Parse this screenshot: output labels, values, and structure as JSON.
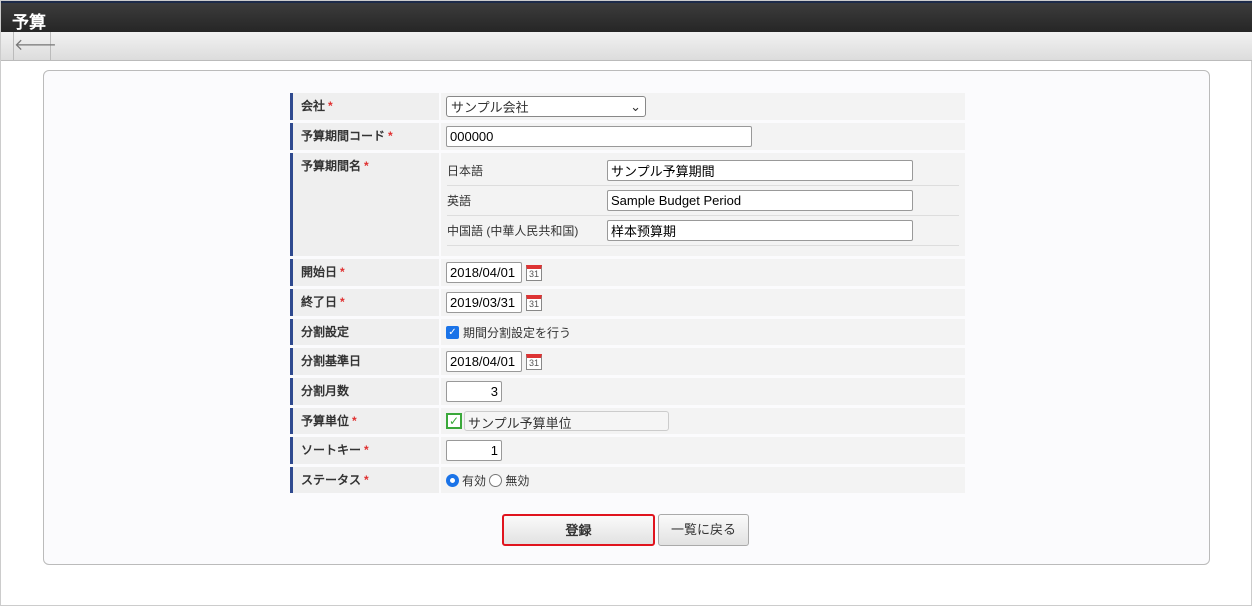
{
  "header": {
    "title": "予算"
  },
  "toolbar": {
    "back": "🡐"
  },
  "form": {
    "company": {
      "label": "会社",
      "value": "サンプル会社"
    },
    "code": {
      "label": "予算期間コード",
      "value": "000000"
    },
    "name": {
      "label": "予算期間名",
      "langs": [
        {
          "label": "日本語",
          "value": "サンプル予算期間"
        },
        {
          "label": "英語",
          "value": "Sample Budget Period"
        },
        {
          "label": "中国語 (中華人民共和国)",
          "value": "样本预算期"
        }
      ]
    },
    "start": {
      "label": "開始日",
      "value": "2018/04/01"
    },
    "end": {
      "label": "終了日",
      "value": "2019/03/31"
    },
    "split": {
      "label": "分割設定",
      "checkbox": "期間分割設定を行う"
    },
    "base": {
      "label": "分割基準日",
      "value": "2018/04/01"
    },
    "months": {
      "label": "分割月数",
      "value": "3"
    },
    "unit": {
      "label": "予算単位",
      "value": "サンプル予算単位"
    },
    "sort": {
      "label": "ソートキー",
      "value": "1"
    },
    "status": {
      "label": "ステータス",
      "options": [
        "有効",
        "無効"
      ]
    },
    "required": "*",
    "cal": "31"
  },
  "buttons": {
    "register": "登録",
    "back_list": "一覧に戻る"
  }
}
